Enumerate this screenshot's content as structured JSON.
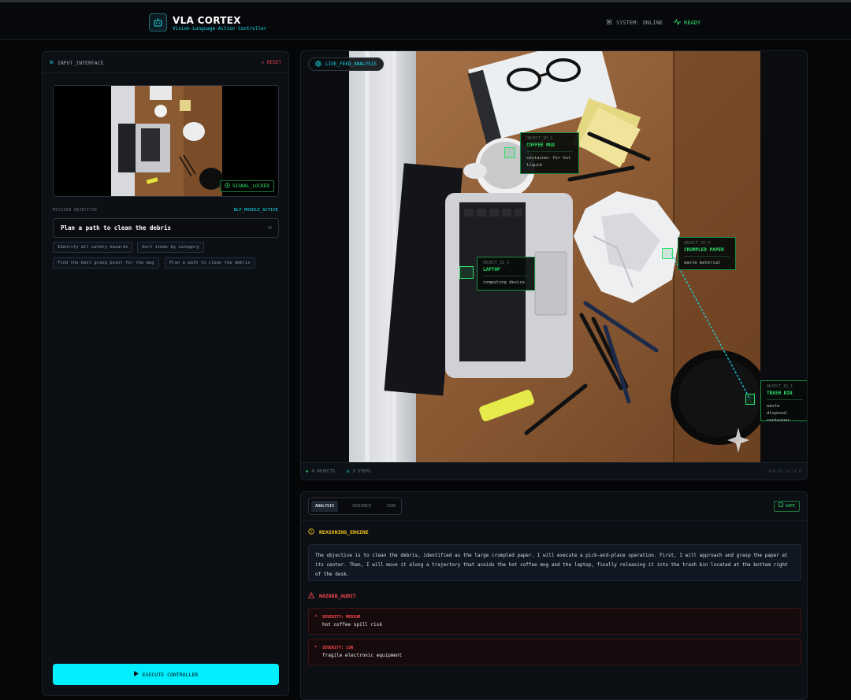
{
  "header": {
    "title": "VLA CORTEX",
    "subtitle": "Vision-Language-Action Controller",
    "system_status": "SYSTEM: ONLINE",
    "ready_status": "READY"
  },
  "input_panel": {
    "title": "INPUT_INTERFACE",
    "reset_label": "RESET",
    "signal_badge": "SIGNAL_LOCKED",
    "mission_label": "MISSION OBJECTIVE",
    "nlp_label": "NLP_MODULE_ACTIVE",
    "mission_value": "Plan a path to clean the debris",
    "suggestions": [
      "Identify all safety hazards",
      "Sort items by category",
      "Find the best grasp point for the mug",
      "Plan a path to clean the debris"
    ],
    "execute_label": "EXECUTE CONTROLLER"
  },
  "live_feed": {
    "badge": "LIVE_FEED_ANALYSIS",
    "objects": [
      {
        "id": "OBJECT_ID_2",
        "name": "COFFEE MUG",
        "desc": "container for hot liquid"
      },
      {
        "id": "OBJECT_ID_0",
        "name": "CRUMPLED PAPER",
        "desc": "waste material"
      },
      {
        "id": "OBJECT_ID_3",
        "name": "LAPTOP",
        "desc": "computing device"
      },
      {
        "id": "OBJECT_ID_1",
        "name": "TRASH BIN",
        "desc": "waste disposal container"
      }
    ],
    "footer_objects": "4 OBJECTS",
    "footer_steps": "3 STEPS",
    "version": "VLA OS v2.4.0"
  },
  "analysis": {
    "tabs": [
      "ANALYSIS",
      "SEQUENCE",
      "JSON"
    ],
    "active_tab": "ANALYSIS",
    "safe_badge": "SAFE",
    "reasoning_title": "REASONING_ENGINE",
    "reasoning_text": "The objective is to clean the debris, identified as the large crumpled paper. I will execute a pick-and-place operation. First, I will approach and grasp the paper at its center. Then, I will move it along a trajectory that avoids the hot coffee mug and the laptop, finally releasing it into the trash bin located at the bottom right of the desk.",
    "hazard_title": "HAZARD_AUDIT",
    "hazards": [
      {
        "severity": "SEVERITY: MEDIUM",
        "desc": "hot coffee spill risk"
      },
      {
        "severity": "SEVERITY: LOW",
        "desc": "fragile electronic equipment"
      }
    ]
  },
  "colors": {
    "accent": "#00eefd",
    "success": "#2ee06a",
    "danger": "#ff4a4a",
    "warning": "#f5c518"
  }
}
